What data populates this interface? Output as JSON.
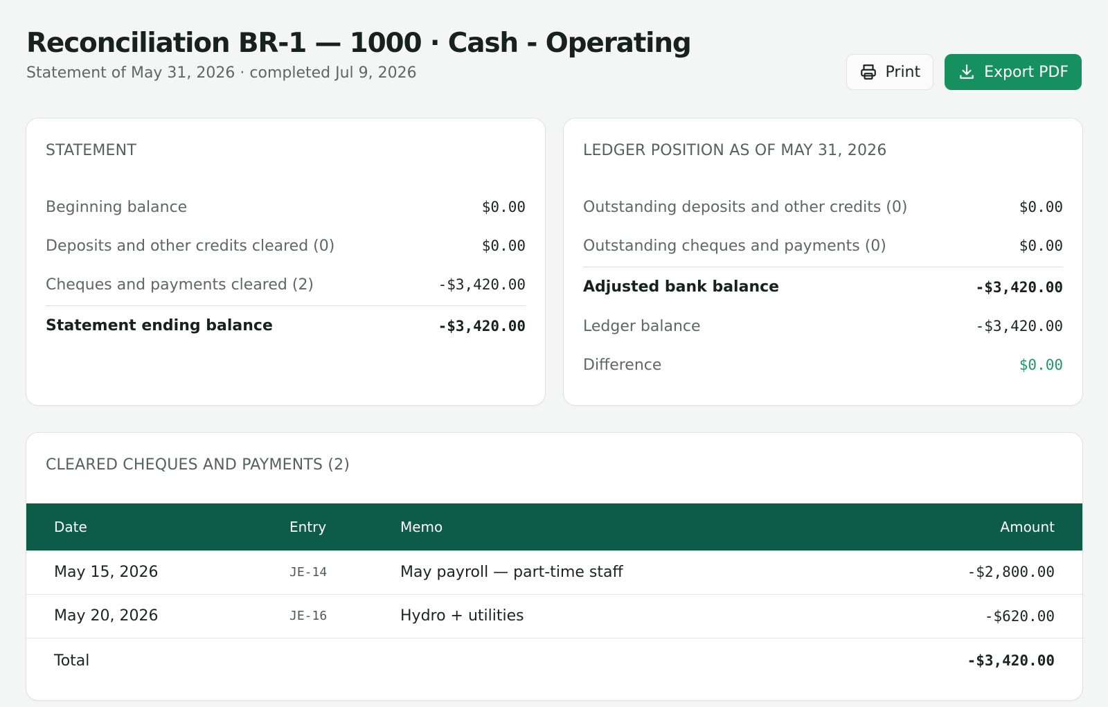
{
  "page": {
    "title": "Reconciliation BR-1 — 1000 · Cash - Operating",
    "subtitle": "Statement of May 31, 2026 · completed Jul 9, 2026"
  },
  "actions": {
    "print_label": "Print",
    "export_label": "Export PDF"
  },
  "statement": {
    "title": "STATEMENT",
    "rows": [
      {
        "label": "Beginning balance",
        "value": "$0.00"
      },
      {
        "label": "Deposits and other credits cleared (0)",
        "value": "$0.00"
      },
      {
        "label": "Cheques and payments cleared (2)",
        "value": "-$3,420.00"
      }
    ],
    "total": {
      "label": "Statement ending balance",
      "value": "-$3,420.00"
    }
  },
  "ledger": {
    "title": "LEDGER POSITION AS OF MAY 31, 2026",
    "rows": [
      {
        "label": "Outstanding deposits and other credits (0)",
        "value": "$0.00"
      },
      {
        "label": "Outstanding cheques and payments (0)",
        "value": "$0.00"
      }
    ],
    "adjusted": {
      "label": "Adjusted bank balance",
      "value": "-$3,420.00"
    },
    "ledger_balance": {
      "label": "Ledger balance",
      "value": "-$3,420.00"
    },
    "difference": {
      "label": "Difference",
      "value": "$0.00"
    }
  },
  "cleared": {
    "title": "CLEARED CHEQUES AND PAYMENTS (2)",
    "columns": {
      "date": "Date",
      "entry": "Entry",
      "memo": "Memo",
      "amount": "Amount"
    },
    "rows": [
      {
        "date": "May 15, 2026",
        "entry": "JE-14",
        "memo": "May payroll — part-time staff",
        "amount": "-$2,800.00"
      },
      {
        "date": "May 20, 2026",
        "entry": "JE-16",
        "memo": "Hydro + utilities",
        "amount": "-$620.00"
      }
    ],
    "total": {
      "label": "Total",
      "amount": "-$3,420.00"
    }
  },
  "icons": {
    "print": "printer-icon",
    "export": "download-icon"
  },
  "colors": {
    "accent": "#17905f",
    "table_header": "#0c5c47",
    "positive": "#1b9a66"
  }
}
